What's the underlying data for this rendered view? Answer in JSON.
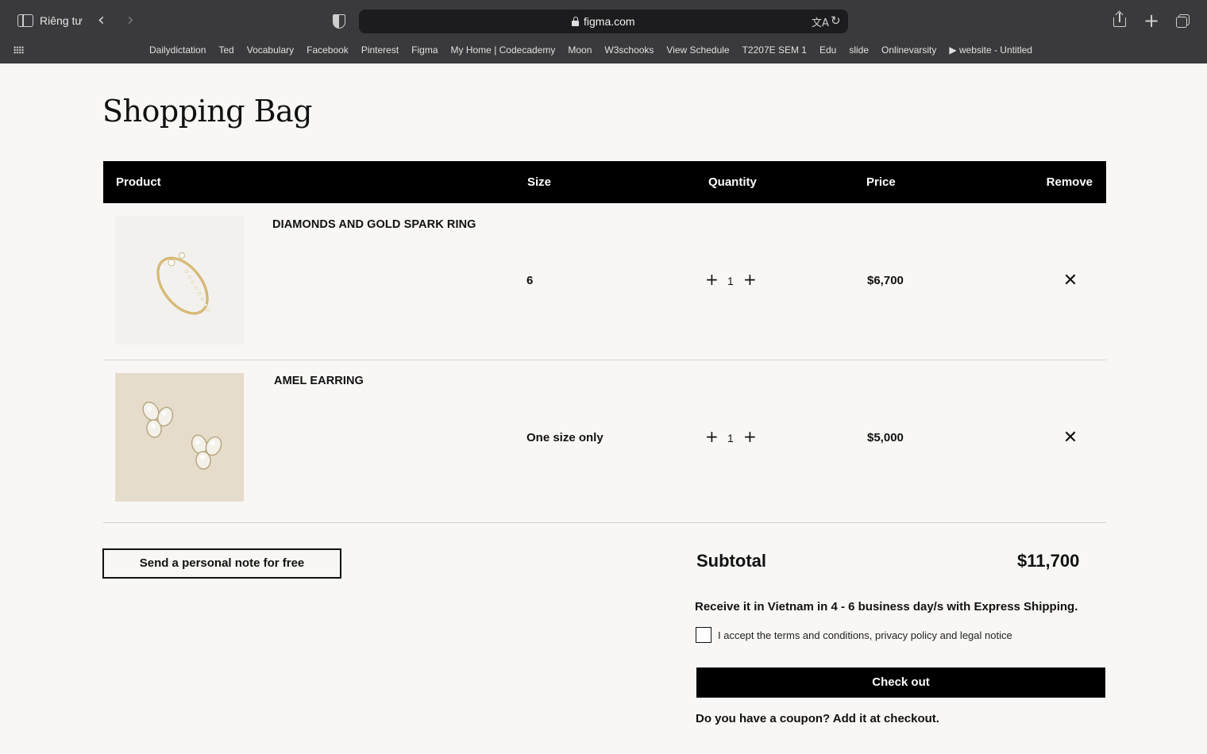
{
  "browser": {
    "private_label": "Riêng tư",
    "url": "figma.com",
    "bookmarks": [
      "Dailydictation",
      "Ted",
      "Vocabulary",
      "Facebook",
      "Pinterest",
      "Figma",
      "My Home | Codecademy",
      "Moon",
      "W3schooks",
      "View Schedule",
      "T2207E SEM 1",
      "Edu",
      "slide",
      "Onlinevarsity",
      "▶ website - Untitled"
    ]
  },
  "page": {
    "title": "Shopping Bag"
  },
  "table": {
    "headers": {
      "product": "Product",
      "size": "Size",
      "quantity": "Quantity",
      "price": "Price",
      "remove": "Remove"
    },
    "rows": [
      {
        "name": "DIAMONDS AND GOLD SPARK RING",
        "size": "6",
        "quantity": "1",
        "price": "$6,700"
      },
      {
        "name": "AMEL EARRING",
        "size": "One size only",
        "quantity": "1",
        "price": "$5,000"
      }
    ]
  },
  "note_button": "Send a personal note for free",
  "summary": {
    "subtotal_label": "Subtotal",
    "subtotal_value": "$11,700",
    "shipping": "Receive it in Vietnam in 4 - 6 business day/s with Express Shipping.",
    "terms": "I accept the terms and conditions, privacy policy and legal notice",
    "checkout": "Check out",
    "coupon": "Do you have a coupon? Add it at checkout."
  }
}
